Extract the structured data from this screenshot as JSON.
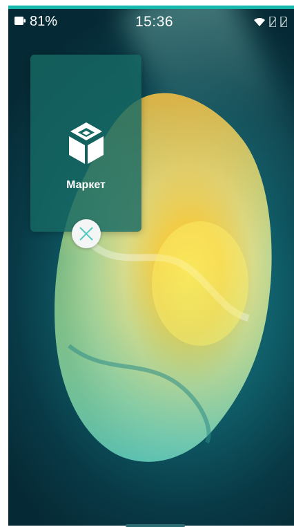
{
  "status_bar": {
    "battery_percent": "81%",
    "time": "15:36",
    "icons": [
      "battery-icon",
      "wifi-icon",
      "sim1-icon",
      "sim2-icon"
    ]
  },
  "recent_app": {
    "label": "Маркет",
    "icon": "market-logo-icon",
    "close_icon": "close-icon"
  },
  "colors": {
    "accent_bar": "#16b7ad",
    "card_background": "#166964",
    "close_x": "#4fc9c0"
  }
}
